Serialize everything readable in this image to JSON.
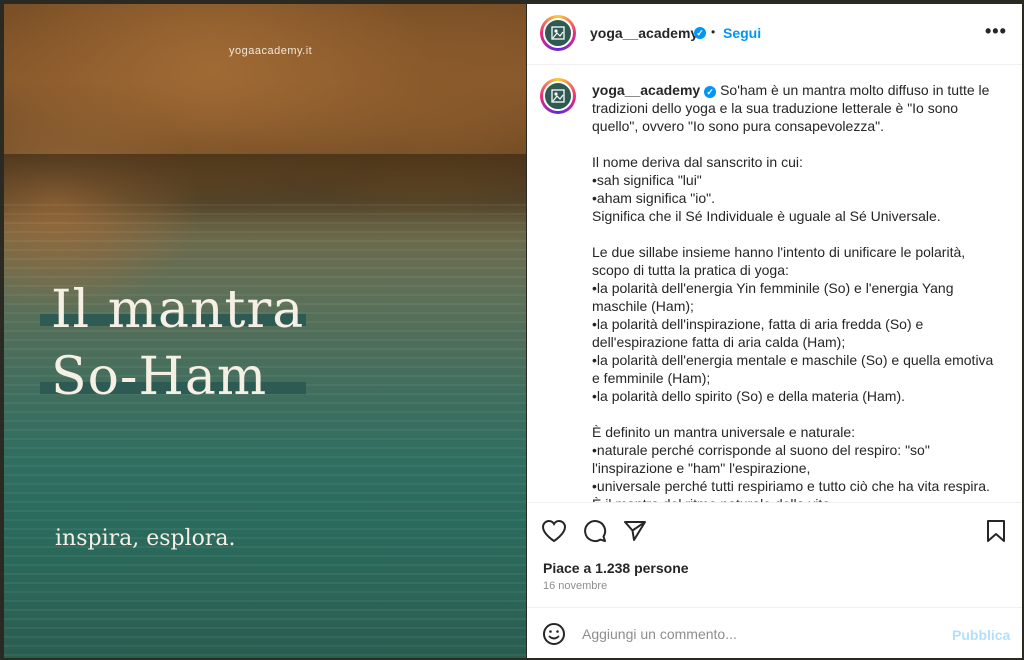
{
  "post": {
    "watermark": "yogaacademy.it",
    "headline_line1": "Il mantra",
    "headline_line2": "So-Ham",
    "tagline": "inspira, esplora."
  },
  "header": {
    "username": "yoga__academy",
    "separator": "•",
    "follow_label": "Segui",
    "more_label": "•••"
  },
  "caption": {
    "username": "yoga__academy",
    "text": " So'ham è un mantra molto diffuso in tutte le tradizioni dello yoga e la sua traduzione letterale è \"Io sono quello\", ovvero \"Io sono pura consapevolezza\".\n\nIl nome deriva dal sanscrito in cui:\n•sah significa \"lui\"\n•aham significa \"io\".\nSignifica che il Sé Individuale è uguale al Sé Universale.\n\nLe due sillabe insieme hanno l'intento di unificare le polarità, scopo di tutta la pratica di yoga:\n•la polarità dell'energia Yin femminile (So) e l'energia Yang maschile (Ham);\n•la polarità dell'inspirazione, fatta di aria fredda (So) e dell'espirazione fatta di aria calda (Ham);\n•la polarità dell'energia mentale e maschile (So) e quella emotiva e femminile (Ham);\n•la polarità dello spirito (So) e della materia (Ham).\n\nÈ definito un mantra universale e naturale:\n•naturale perché corrisponde al suono del respiro: \"so\" l'inspirazione e \"ham\" l'espirazione,\n•universale perché tutti respiriamo e tutto ciò che ha vita respira.\nÈ il mantra del ritmo naturale della vita."
  },
  "actions": {
    "like_icon": "heart-icon",
    "comment_icon": "comment-icon",
    "share_icon": "paper-plane-icon",
    "save_icon": "bookmark-icon",
    "likes_text": "Piace a 1.238 persone",
    "date_text": "16 novembre"
  },
  "comment": {
    "emoji_icon": "smiley-icon",
    "placeholder": "Aggiungi un commento...",
    "publish_label": "Pubblica"
  },
  "colors": {
    "accent": "#0095f6",
    "publish_disabled": "#b2dffc",
    "headline_bar": "#2d5a52"
  }
}
